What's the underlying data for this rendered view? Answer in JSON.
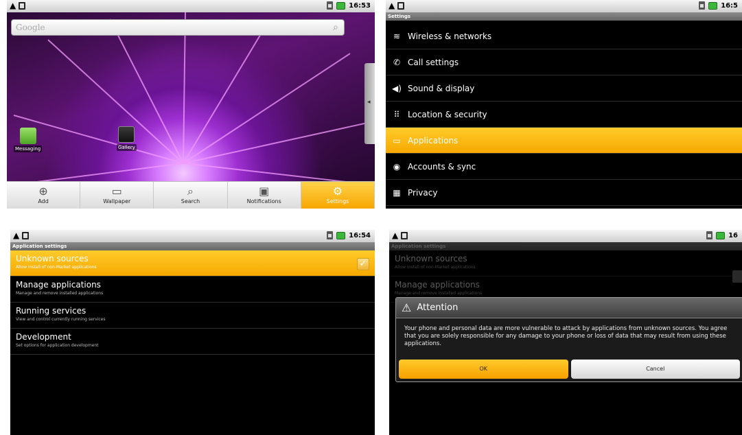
{
  "status": {
    "time_home": "16:53",
    "time_settings": "16:5",
    "time_app_settings": "16:54",
    "time_dialog": "16"
  },
  "home": {
    "search_placeholder": "Google",
    "shortcuts": [
      {
        "label": "Messaging",
        "icon": "messaging-icon"
      },
      {
        "label": "Gallery",
        "icon": "gallery-icon"
      }
    ],
    "menu": [
      {
        "label": "Add",
        "icon": "add-icon"
      },
      {
        "label": "Wallpaper",
        "icon": "wallpaper-icon"
      },
      {
        "label": "Search",
        "icon": "search-icon"
      },
      {
        "label": "Notifications",
        "icon": "notifications-icon"
      },
      {
        "label": "Settings",
        "icon": "settings-icon",
        "selected": true
      }
    ]
  },
  "settings": {
    "title": "Settings",
    "items": [
      {
        "label": "Wireless & networks",
        "icon": "wireless-icon"
      },
      {
        "label": "Call settings",
        "icon": "phone-icon"
      },
      {
        "label": "Sound & display",
        "icon": "speaker-icon"
      },
      {
        "label": "Location & security",
        "icon": "grid-icon"
      },
      {
        "label": "Applications",
        "icon": "applications-icon",
        "selected": true
      },
      {
        "label": "Accounts & sync",
        "icon": "sync-icon"
      },
      {
        "label": "Privacy",
        "icon": "privacy-icon"
      }
    ]
  },
  "app_settings": {
    "title": "Application settings",
    "items": [
      {
        "title": "Unknown sources",
        "subtitle": "Allow install of non-Market applications",
        "checked": true
      },
      {
        "title": "Manage applications",
        "subtitle": "Manage and remove installed applications"
      },
      {
        "title": "Running services",
        "subtitle": "View and control currently running services"
      },
      {
        "title": "Development",
        "subtitle": "Set options for application development"
      }
    ]
  },
  "dialog": {
    "title": "Attention",
    "message": "Your phone and personal data are more vulnerable to attack by applications from unknown sources. You agree that you are solely responsible for any damage to your phone or loss of data that may result from using these applications.",
    "ok_label": "OK",
    "cancel_label": "Cancel"
  },
  "colors": {
    "accent": "#f6a800",
    "accent_light": "#ffcb2b"
  }
}
